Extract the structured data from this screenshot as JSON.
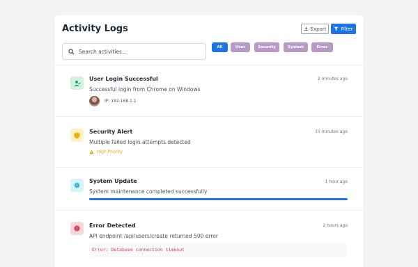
{
  "header": {
    "title": "Activity Logs",
    "export_label": "Export",
    "filter_label": "Filter"
  },
  "search": {
    "placeholder": "Search activities...",
    "value": ""
  },
  "filters": [
    {
      "label": "All",
      "active": true
    },
    {
      "label": "User",
      "active": false
    },
    {
      "label": "Security",
      "active": false
    },
    {
      "label": "System",
      "active": false
    },
    {
      "label": "Error",
      "active": false
    }
  ],
  "activities": [
    {
      "title": "User Login Successful",
      "time": "2 minutes ago",
      "description": "Successful login from Chrome on Windows",
      "ip": "IP: 192.168.1.1",
      "icon": "user-check-icon",
      "icon_color": "#2f9e6a",
      "icon_bg": "#d1f0e0"
    },
    {
      "title": "Security Alert",
      "time": "15 minutes ago",
      "description": "Multiple failed login attempts detected",
      "priority": "High Priority",
      "icon": "shield-icon",
      "icon_color": "#f0b400",
      "icon_bg": "#fff1c7"
    },
    {
      "title": "System Update",
      "time": "1 hour ago",
      "description": "System maintenance completed successfully",
      "progress": 1.0,
      "icon": "gear-icon",
      "icon_color": "#1aa6c7",
      "icon_bg": "#d5f3fa"
    },
    {
      "title": "Error Detected",
      "time": "2 hours ago",
      "description": "API endpoint /api/users/create returned 500 error",
      "error_code": "Error: Database connection timeout",
      "icon": "error-icon",
      "icon_color": "#e03c52",
      "icon_bg": "#fbd5da"
    }
  ],
  "colors": {
    "accent": "#1d74e7",
    "chip_inactive": "#b79bc6",
    "priority": "#e0a800",
    "error_text": "#d6336c"
  }
}
